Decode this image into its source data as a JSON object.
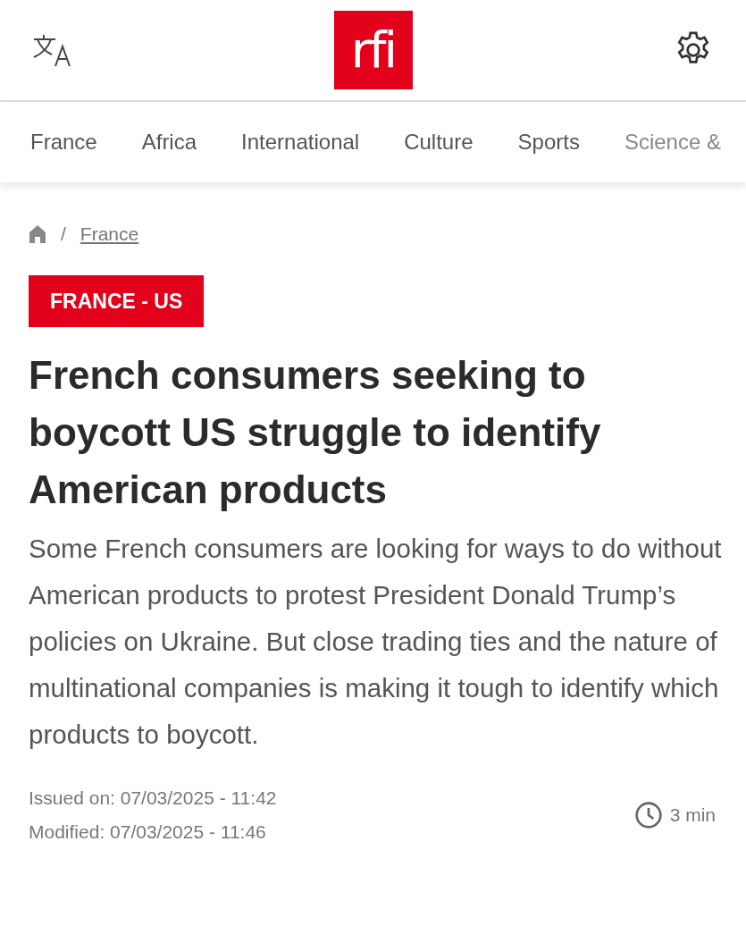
{
  "header": {
    "logo": "rfi"
  },
  "nav": [
    {
      "label": "France"
    },
    {
      "label": "Africa"
    },
    {
      "label": "International"
    },
    {
      "label": "Culture"
    },
    {
      "label": "Sports"
    },
    {
      "label": "Science &"
    }
  ],
  "breadcrumb": {
    "separator": "/",
    "current": "France"
  },
  "article": {
    "tag": "FRANCE - US",
    "title": "French consumers seeking to boycott US struggle to identify American products",
    "summary": "Some French consumers are looking for ways to do without American products to protest President Donald Trump’s policies on Ukraine. But close trading ties and the nature of multinational companies is making it tough to identify which products to boycott.",
    "issued": "Issued on: 07/03/2025 - 11:42",
    "modified": "Modified: 07/03/2025 - 11:46",
    "reading_time": "3 min"
  }
}
